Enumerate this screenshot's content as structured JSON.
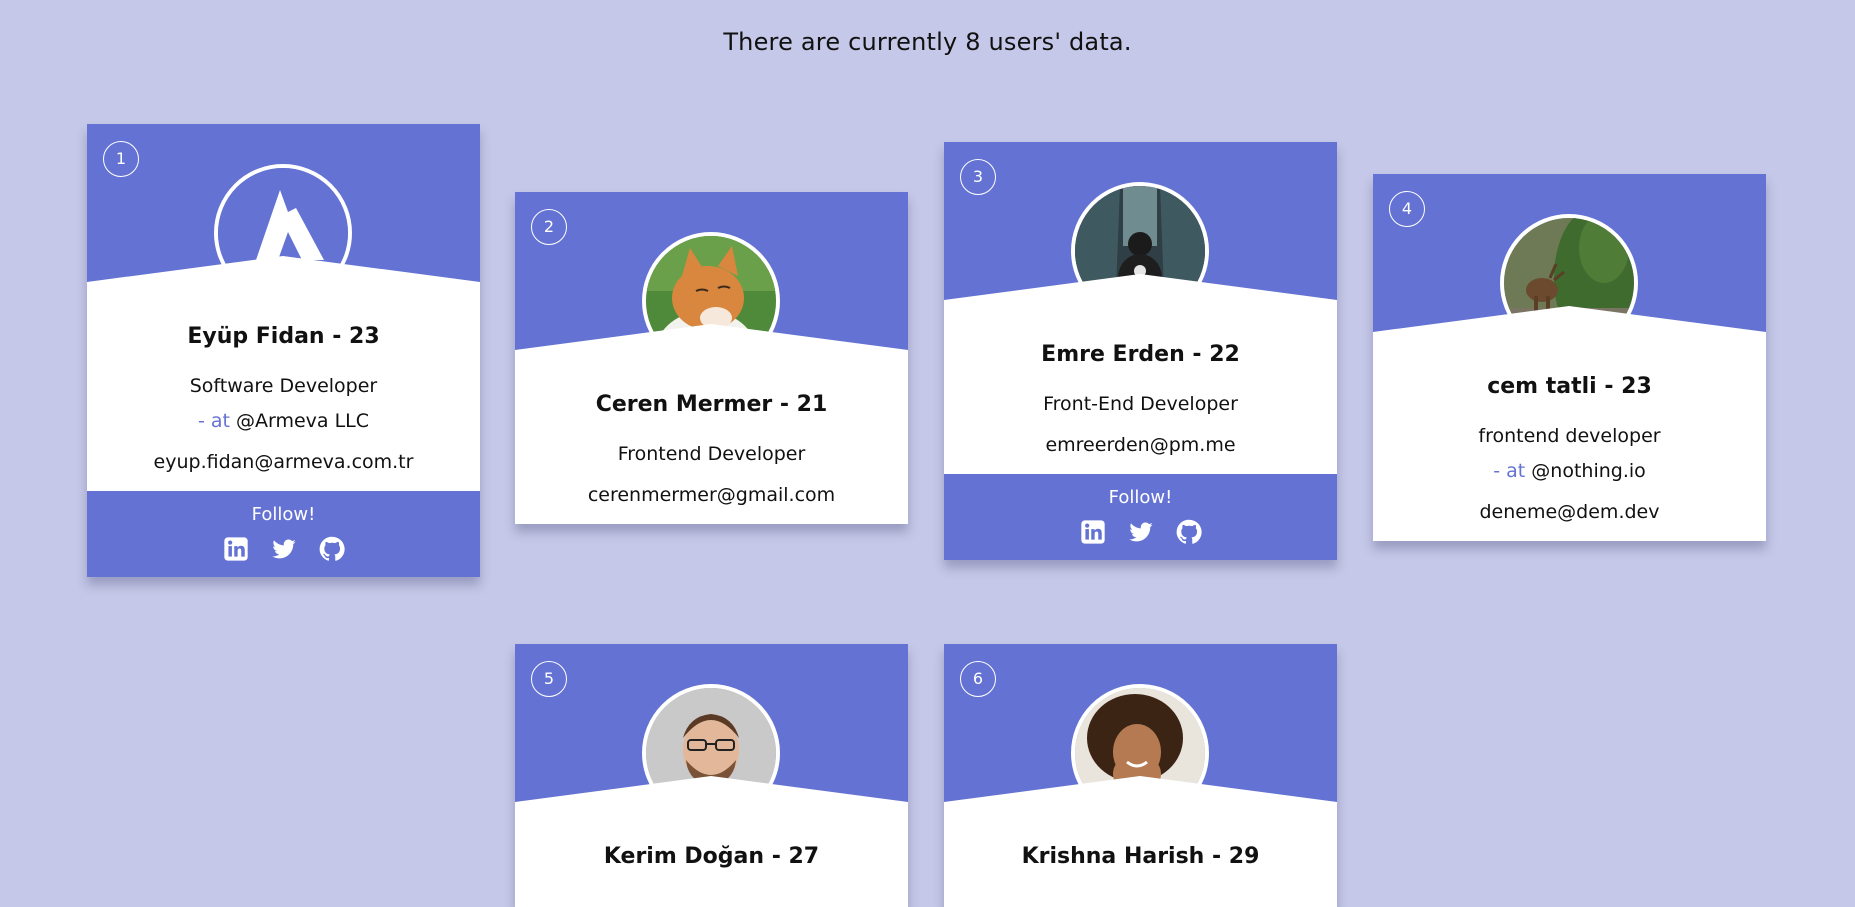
{
  "header": {
    "text": "There are currently 8 users' data."
  },
  "colors": {
    "accent": "#6473d3",
    "background": "#c5c8e8",
    "card": "#ffffff"
  },
  "footer": {
    "follow_label": "Follow!"
  },
  "cards": [
    {
      "number": "1",
      "name": "Eyüp Fidan - 23",
      "title": "Software Developer",
      "company_prefix": "- at",
      "company": "@Armeva LLC",
      "email": "eyup.fidan@armeva.com.tr",
      "avatar": "armeva-logo",
      "has_follow": true
    },
    {
      "number": "2",
      "name": "Ceren Mermer - 21",
      "title": "Frontend Developer",
      "email": "cerenmermer@gmail.com",
      "avatar": "cat-photo",
      "has_follow": false
    },
    {
      "number": "3",
      "name": "Emre Erden - 22",
      "title": "Front-End Developer",
      "email": "emreerden@pm.me",
      "avatar": "subway-person-photo",
      "has_follow": true
    },
    {
      "number": "4",
      "name": "cem tatli - 23",
      "title": "frontend developer",
      "company_prefix": "- at",
      "company": "@nothing.io",
      "email": "deneme@dem.dev",
      "avatar": "deer-photo",
      "has_follow": false
    },
    {
      "number": "5",
      "name": "Kerim Doğan - 27",
      "avatar": "man-glasses-photo"
    },
    {
      "number": "6",
      "name": "Krishna Harish - 29",
      "avatar": "smiling-woman-photo"
    }
  ],
  "icons": {
    "linkedin": "linkedin-icon",
    "twitter": "twitter-icon",
    "github": "github-icon"
  }
}
